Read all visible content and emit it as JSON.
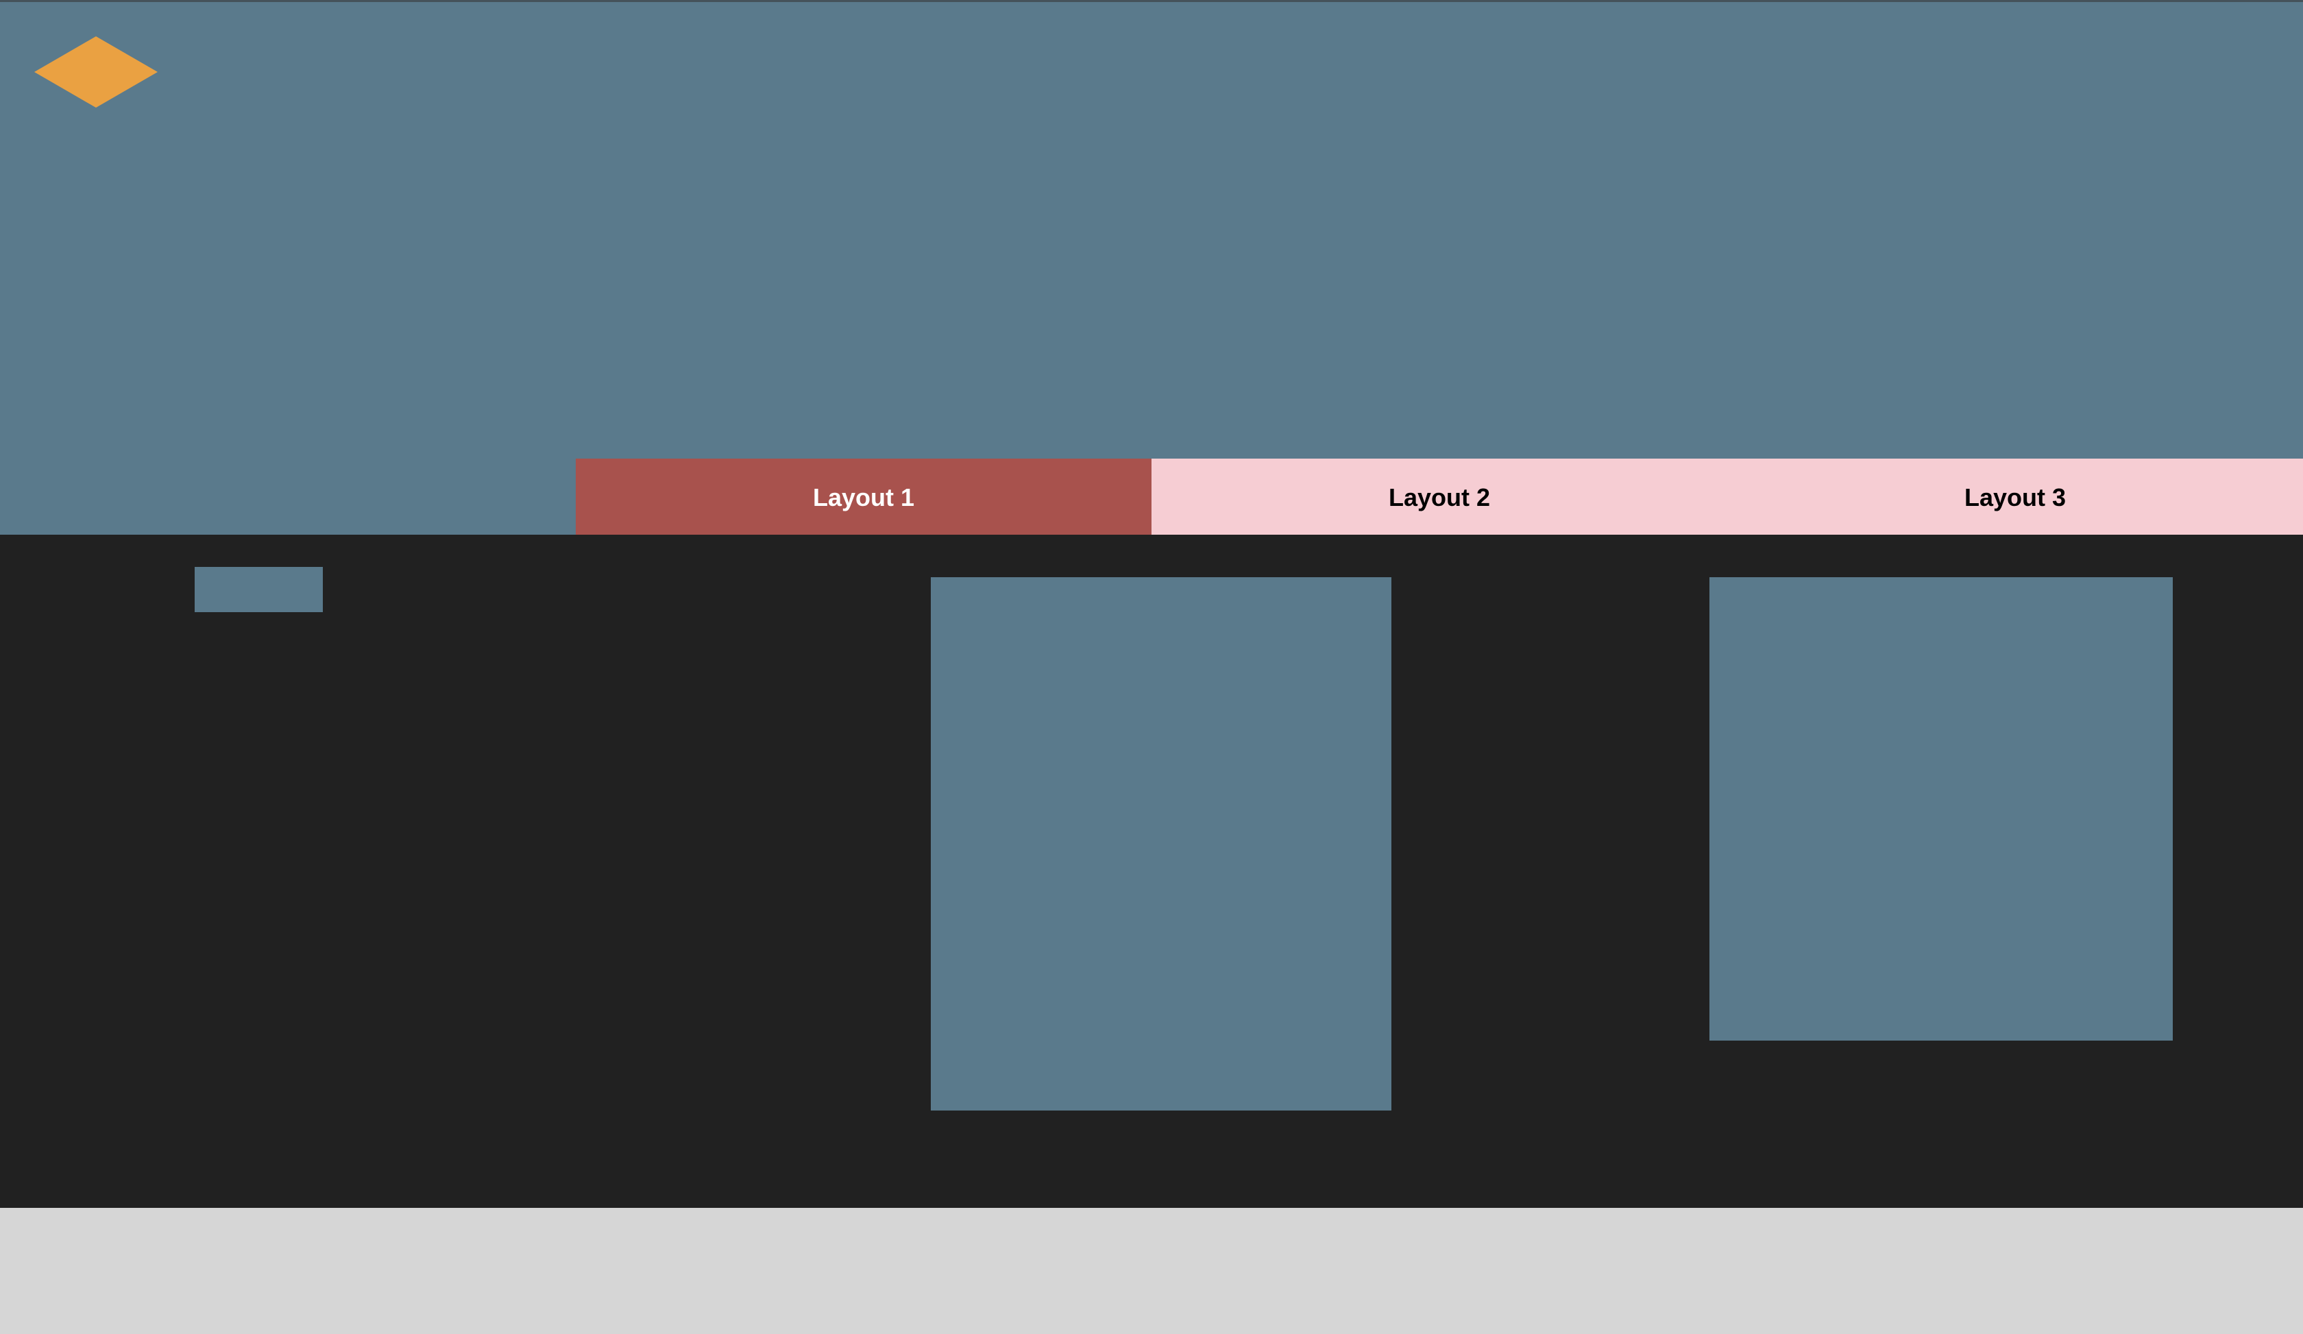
{
  "header": {
    "logo_icon": "diamond-logo-icon",
    "background_color": "#5a7a8c",
    "logo_color": "#eaa142"
  },
  "tabs": [
    {
      "label": "Layout 1",
      "active": true,
      "background_color": "#a8524d",
      "text_color": "#ffffff"
    },
    {
      "label": "Layout 2",
      "active": false,
      "background_color": "#f6cdd3",
      "text_color": "#000000"
    },
    {
      "label": "Layout 3",
      "active": false,
      "background_color": "#f6cdd3",
      "text_color": "#000000"
    }
  ],
  "content": {
    "background_color": "#212121",
    "block_color": "#5a7a8c"
  },
  "footer": {
    "background_color": "#d6d6d6"
  }
}
